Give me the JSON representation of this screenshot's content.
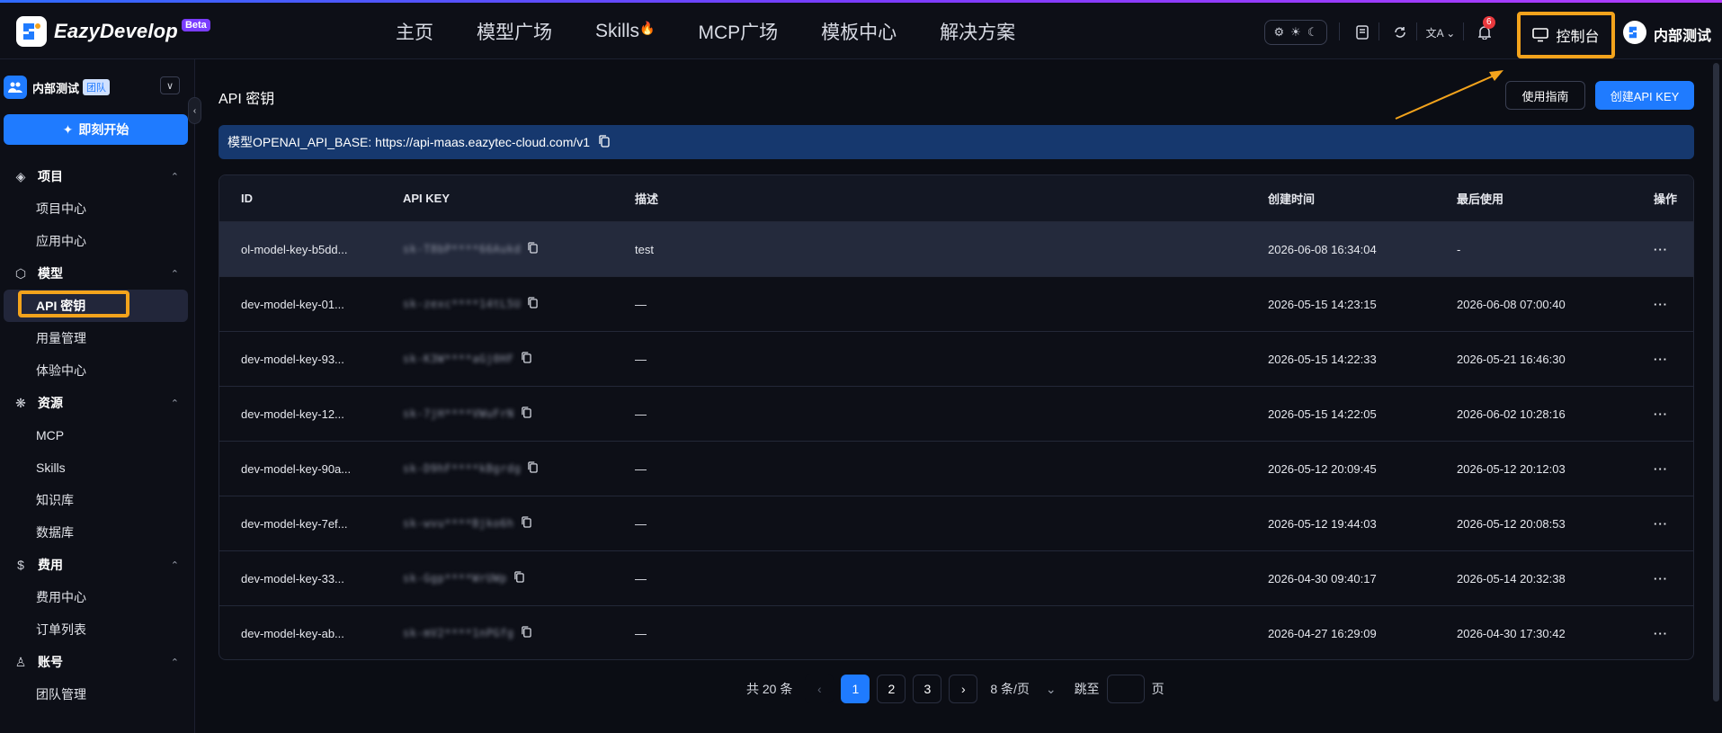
{
  "brand": {
    "name": "EazyDevelop",
    "tag": "Beta"
  },
  "topnav": [
    {
      "label": "主页"
    },
    {
      "label": "模型广场"
    },
    {
      "label": "Skills"
    },
    {
      "label": "MCP广场"
    },
    {
      "label": "模板中心"
    },
    {
      "label": "解决方案"
    }
  ],
  "header": {
    "notifications_count": "6",
    "console_label": "控制台",
    "user_name": "内部测试"
  },
  "sidebar": {
    "team_name": "内部测试",
    "team_tag": "团队",
    "start_label": "即刻开始",
    "groups": [
      {
        "label": "项目",
        "icon": "layers-icon",
        "items": [
          "项目中心",
          "应用中心"
        ]
      },
      {
        "label": "模型",
        "icon": "cube-icon",
        "items": [
          "API 密钥",
          "用量管理",
          "体验中心"
        ]
      },
      {
        "label": "资源",
        "icon": "atom-icon",
        "items": [
          "MCP",
          "Skills",
          "知识库",
          "数据库"
        ]
      },
      {
        "label": "费用",
        "icon": "dollar-icon",
        "items": [
          "费用中心",
          "订单列表"
        ]
      },
      {
        "label": "账号",
        "icon": "user-icon",
        "items": [
          "团队管理"
        ]
      }
    ],
    "active_item": "API 密钥"
  },
  "main": {
    "title": "API 密钥",
    "guide_label": "使用指南",
    "create_label": "创建API KEY",
    "base_url_text": "模型OPENAI_API_BASE: https://api-maas.eazytec-cloud.com/v1"
  },
  "table": {
    "columns": [
      "ID",
      "API KEY",
      "描述",
      "创建时间",
      "最后使用",
      "操作"
    ],
    "rows": [
      {
        "id": "ol-model-key-b5dd...",
        "key": "sk-T8bP****66Aukd",
        "desc": "test",
        "created": "2026-06-08 16:34:04",
        "last_used": "-"
      },
      {
        "id": "dev-model-key-01...",
        "key": "sk-zexc****14tL5U",
        "desc": "—",
        "created": "2026-05-15 14:23:15",
        "last_used": "2026-06-08 07:00:40"
      },
      {
        "id": "dev-model-key-93...",
        "key": "sk-K3W****aGj0HF",
        "desc": "—",
        "created": "2026-05-15 14:22:33",
        "last_used": "2026-05-21 16:46:30"
      },
      {
        "id": "dev-model-key-12...",
        "key": "sk-7jH****VWuFrN",
        "desc": "—",
        "created": "2026-05-15 14:22:05",
        "last_used": "2026-06-02 10:28:16"
      },
      {
        "id": "dev-model-key-90a...",
        "key": "sk-D9hF****kBgrdg",
        "desc": "—",
        "created": "2026-05-12 20:09:45",
        "last_used": "2026-05-12 20:12:03"
      },
      {
        "id": "dev-model-key-7ef...",
        "key": "sk-wvu****Bjko6h",
        "desc": "—",
        "created": "2026-05-12 19:44:03",
        "last_used": "2026-05-12 20:08:53"
      },
      {
        "id": "dev-model-key-33...",
        "key": "sk-Ggp****WrUWp",
        "desc": "—",
        "created": "2026-04-30 09:40:17",
        "last_used": "2026-05-14 20:32:38"
      },
      {
        "id": "dev-model-key-ab...",
        "key": "sk-mV2****1nPGfg",
        "desc": "—",
        "created": "2026-04-27 16:29:09",
        "last_used": "2026-04-30 17:30:42"
      }
    ],
    "actions_label": "···"
  },
  "pagination": {
    "total": "共 20 条",
    "pages": [
      "1",
      "2",
      "3"
    ],
    "current": "1",
    "page_size": "8 条/页",
    "jump_label": "跳至",
    "page_unit": "页"
  },
  "colors": {
    "accent": "#1f7bff",
    "highlight": "#f3a31c",
    "background": "#0b0d14",
    "base_bar": "#16386e"
  }
}
